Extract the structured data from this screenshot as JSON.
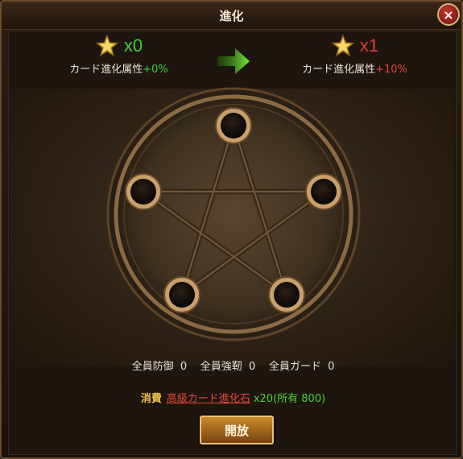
{
  "dialog": {
    "title": "進化",
    "close_label": "×"
  },
  "current": {
    "multiplier": "x0",
    "attr_label": "カード進化属性",
    "attr_bonus": "+0%"
  },
  "next": {
    "multiplier": "x1",
    "attr_label": "カード進化属性",
    "attr_bonus": "+10%"
  },
  "slots": {
    "count": 5,
    "filled": 0
  },
  "stats": {
    "defense_label": "全員防御",
    "defense_value": "0",
    "toughness_label": "全員強靭",
    "toughness_value": "0",
    "guard_label": "全員ガード",
    "guard_value": "0"
  },
  "cost": {
    "label": "消費",
    "item": "高級カード進化石",
    "count": "x20(所有 800)"
  },
  "action": {
    "open_label": "開放"
  },
  "colors": {
    "accent_gold": "#f0c24a",
    "positive_green": "#3fd12f",
    "negative_red": "#e03b3b",
    "frame_bronze": "#8a6a43"
  }
}
